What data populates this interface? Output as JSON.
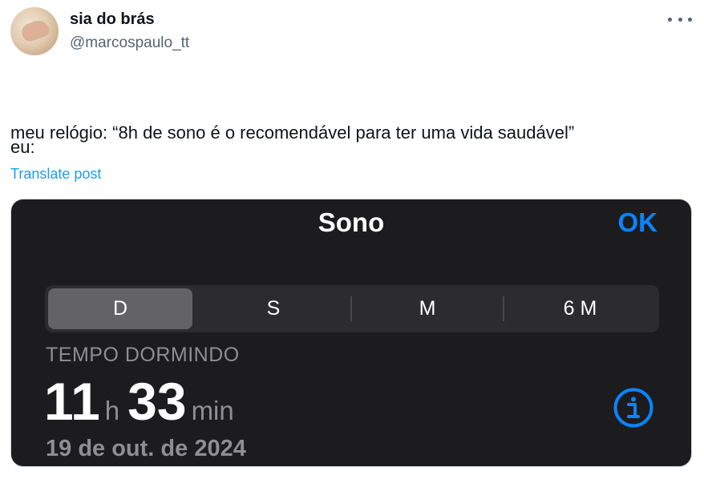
{
  "author": {
    "display_name": "sia do brás",
    "handle": "@marcospaulo_tt"
  },
  "post": {
    "text_line1": "meu relógio: “8h de sono é o recomendável para ter uma vida saudável”",
    "text_line2": "eu:",
    "translate_label": "Translate post"
  },
  "icons": {
    "more": "more-horizontal-icon",
    "info": "info-circle-icon"
  },
  "media": {
    "title": "Sono",
    "ok_label": "OK",
    "segments": [
      {
        "label": "D",
        "selected": true
      },
      {
        "label": "S",
        "selected": false
      },
      {
        "label": "M",
        "selected": false
      },
      {
        "label": "6 M",
        "selected": false
      }
    ],
    "metric_label": "TEMPO DORMINDO",
    "hours": "11",
    "hours_unit": "h",
    "minutes": "33",
    "minutes_unit": "min",
    "date": "19 de out. de 2024"
  },
  "colors": {
    "link_blue": "#1d9bf0",
    "ios_blue": "#0a84ff",
    "sheet_bg": "#1c1c1e",
    "segment_bg": "#2c2c2e",
    "segment_selected": "#636366",
    "secondary_gray": "#8e8e93"
  }
}
